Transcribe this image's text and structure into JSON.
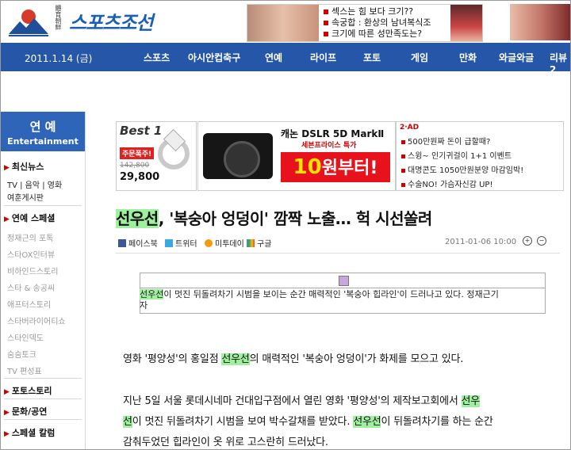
{
  "header": {
    "logo_vertical": "體育朝鮮",
    "logo_text": "스포츠조선",
    "top_ad_lines": [
      "섹스는 힘 보다 크기??",
      "속궁합 : 환상의 남녀복식조",
      "크기에 따른 성만족도는?"
    ]
  },
  "nav": {
    "date": "2011.1.14 (금)",
    "items": [
      "스포츠",
      "아시안컵축구",
      "연예",
      "라이프",
      "포토",
      "게임",
      "만화",
      "와글와글",
      "리뷰2"
    ]
  },
  "sidebar": {
    "title_ko": "연 예",
    "title_en": "Entertainment",
    "sections": [
      {
        "label": "최신뉴스"
      },
      {
        "label": "연예 스페셜"
      },
      {
        "label": "포토스토리"
      },
      {
        "label": "문화/공연"
      },
      {
        "label": "스페셜 칼럼"
      }
    ],
    "news_links": [
      "TV | 음악 | 영화",
      "여훈게시판"
    ],
    "special_links": [
      "정재근의 포톡",
      "스타OX인터뷰",
      "비하인드스토리",
      "스타 & 송공씨",
      "애프터스토리",
      "스타버라이어티쇼",
      "스타인덱도",
      "숨숨토크",
      "TV 편성표"
    ]
  },
  "ads": {
    "best": {
      "title": "Best 1",
      "badge": "주문폭주!",
      "old_price": "142,800",
      "price": "29,800"
    },
    "camera": {
      "title": "캐논 DSLR 5D MarkⅡ",
      "subtitle": "세븐프라이스 특가",
      "big_num": "10",
      "big_text": "원부터!"
    },
    "list": {
      "tag": "2·AD",
      "rows": [
        "500만원짜 돈이 급할때?",
        "스윙~ 인기귀걸이 1+1 이벤트",
        "대명콘도 1050만원분양 마감임박!",
        "수술NO! 가슴자신감 UP!"
      ]
    }
  },
  "article": {
    "title_hl": "선우선",
    "title_rest": ", '복숭아 엉덩이' 깜짝 노출… 헉 시선쏠려",
    "share": [
      "페이스북",
      "트위터",
      "미투데이",
      "구글"
    ],
    "date": "2011-01-06 10:00",
    "caption_hl": "선우선",
    "caption_rest1": "이 멋진 뒤돌려차기 시범을 보이는 순간 매력적인 '복숭아 힙라인'이 드러나고 있다. 정재근기",
    "caption_rest2": "자",
    "p1_a": "영화 '평양성'의 홍일점 ",
    "p1_hl": "선우선",
    "p1_b": "의 매력적인 '복숭아 엉덩이'가 화제를 모으고 있다.",
    "p2_a": "지난 5일 서울 롯데시네마 건대입구점에서 열린 영화 '평양성'의 제작보고회에서 ",
    "p2_hl1": "선우",
    "p2_hl2": "선",
    "p2_b": "이 멋진 뒤돌려차기 시범을 보여 박수갈채를 받았다. ",
    "p2_hl3": "선우선",
    "p2_c": "이 뒤돌려차기를 하는 순간",
    "p2_d": "감춰두었던 힙라인이 옷 위로 고스란히 드러났다."
  },
  "colors": {
    "nav_bg": "#2556a8",
    "logo": "#1a5fb6",
    "highlight": "#9ef09e"
  }
}
